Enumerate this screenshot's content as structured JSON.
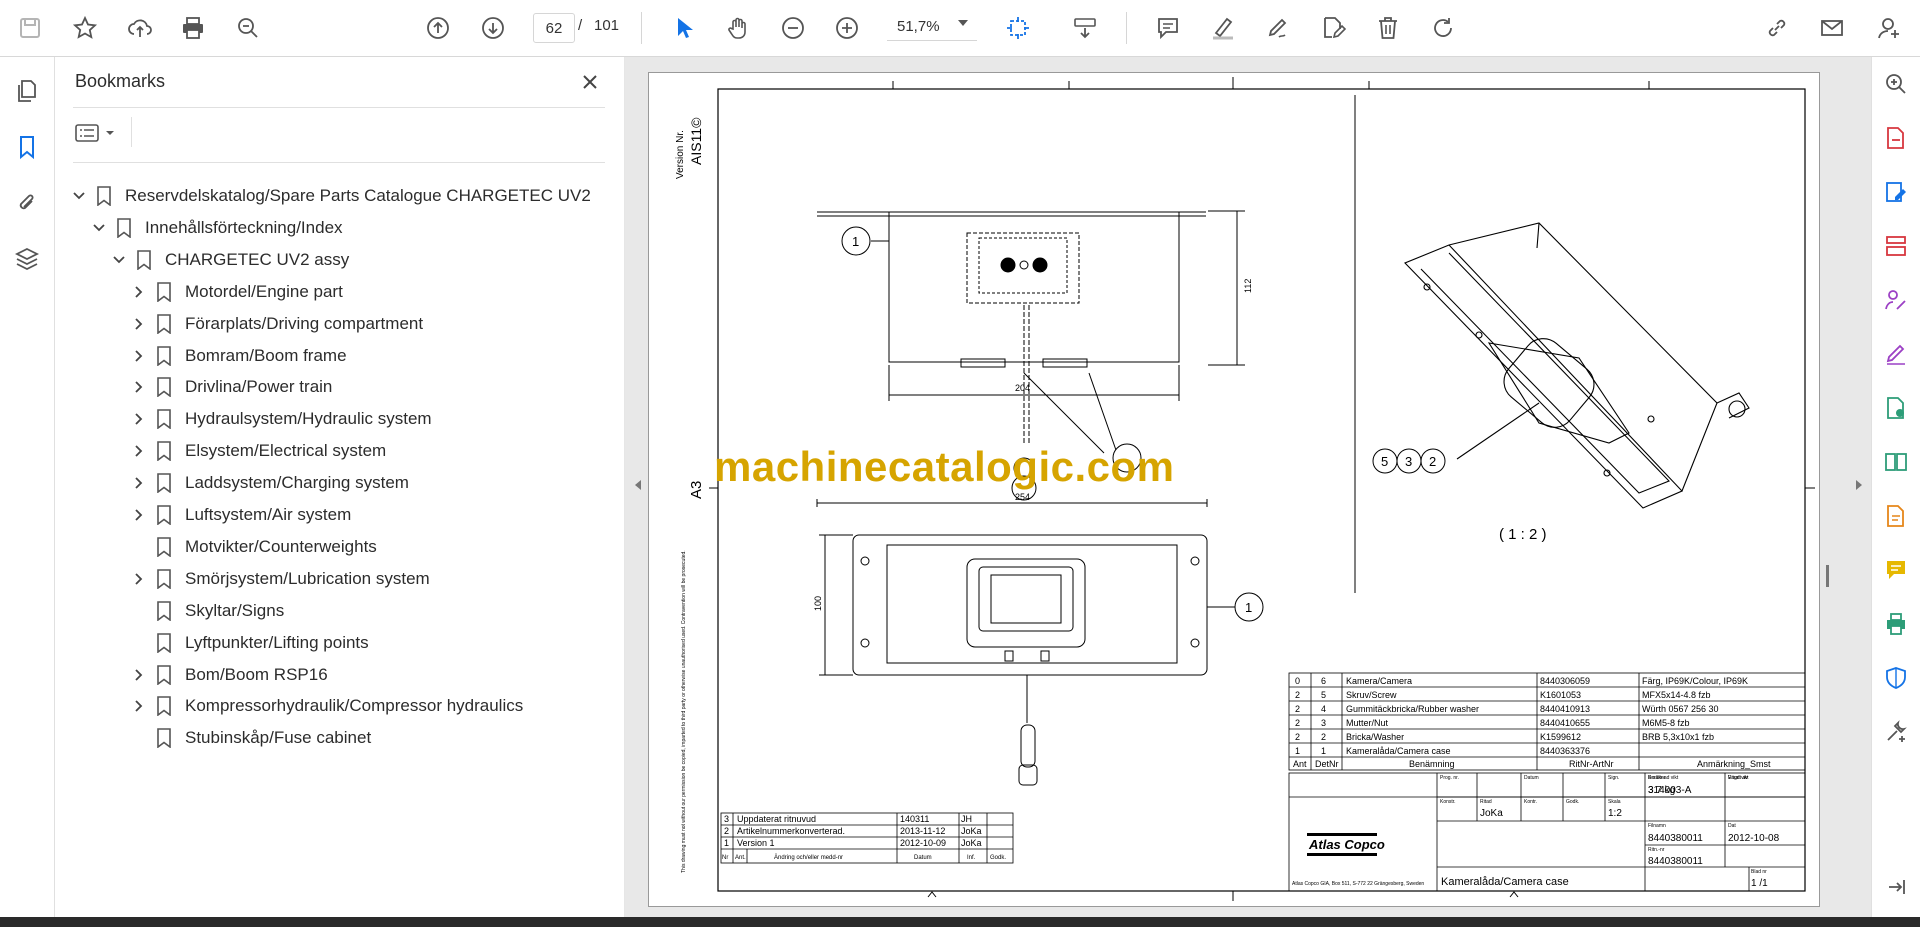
{
  "toolbar": {
    "current_page": "62",
    "page_separator": "/",
    "total_pages": "101",
    "zoom": "51,7%"
  },
  "bookmarks_panel": {
    "title": "Bookmarks",
    "items": [
      {
        "label": "Reservdelskatalog/Spare Parts Catalogue CHARGETEC UV2",
        "level": 0,
        "expanded": true
      },
      {
        "label": "Innehållsförteckning/Index",
        "level": 1,
        "expanded": true
      },
      {
        "label": "CHARGETEC UV2 assy",
        "level": 2,
        "expanded": true
      },
      {
        "label": "Motordel/Engine part",
        "level": 3,
        "expanded": false
      },
      {
        "label": "Förarplats/Driving compartment",
        "level": 3,
        "expanded": false
      },
      {
        "label": "Bomram/Boom frame",
        "level": 3,
        "expanded": false
      },
      {
        "label": "Drivlina/Power train",
        "level": 3,
        "expanded": false
      },
      {
        "label": "Hydraulsystem/Hydraulic system",
        "level": 3,
        "expanded": false
      },
      {
        "label": "Elsystem/Electrical system",
        "level": 3,
        "expanded": false
      },
      {
        "label": "Laddsystem/Charging system",
        "level": 3,
        "expanded": false
      },
      {
        "label": "Luftsystem/Air system",
        "level": 3,
        "expanded": false
      },
      {
        "label": "Motvikter/Counterweights",
        "level": 3,
        "expanded": null
      },
      {
        "label": "Smörjsystem/Lubrication system",
        "level": 3,
        "expanded": false
      },
      {
        "label": "Skyltar/Signs",
        "level": 3,
        "expanded": null
      },
      {
        "label": "Lyftpunkter/Lifting points",
        "level": 3,
        "expanded": null
      },
      {
        "label": "Bom/Boom RSP16",
        "level": 3,
        "expanded": false
      },
      {
        "label": "Kompressorhydraulik/Compressor hydraulics",
        "level": 3,
        "expanded": false
      },
      {
        "label": "Stubinskåp/Fuse cabinet",
        "level": 3,
        "expanded": null
      }
    ]
  },
  "drawing": {
    "version_label": "Version Nr.",
    "version_value": "AIS11©",
    "sheet_size": "A3",
    "watermark": "machinecatalogic.com",
    "scale_caption": "( 1 : 2 )",
    "dimensions": {
      "d112": "112",
      "d204": "204",
      "d254": "254",
      "d100": "100"
    },
    "callouts": {
      "c1": "1",
      "c5": "5",
      "c3": "3",
      "c2": "2"
    },
    "side_note": "This drawing must not without our permission be copied, imparted to third party or otherwise unauthorised used. Contravention will be prosecuted.",
    "parts_list": {
      "rows": [
        {
          "ant": "0",
          "detnr": "6",
          "benamning": "Kamera/Camera",
          "ritnr": "8440306059",
          "anm": "Färg, IP69K/Colour, IP69K"
        },
        {
          "ant": "2",
          "detnr": "5",
          "benamning": "Skruv/Screw",
          "ritnr": "K1601053",
          "anm": "MFX5x14-4.8 fzb"
        },
        {
          "ant": "2",
          "detnr": "4",
          "benamning": "Gummitäckbricka/Rubber washer",
          "ritnr": "8440410913",
          "anm": "Würth 0567 256 30"
        },
        {
          "ant": "2",
          "detnr": "3",
          "benamning": "Mutter/Nut",
          "ritnr": "8440410655",
          "anm": "M6M5-8 fzb"
        },
        {
          "ant": "2",
          "detnr": "2",
          "benamning": "Bricka/Washer",
          "ritnr": "K1599612",
          "anm": "BRB 5,3x10x1 fzb"
        },
        {
          "ant": "1",
          "detnr": "1",
          "benamning": "Kameralåda/Camera case",
          "ritnr": "8440363376",
          "anm": ""
        }
      ],
      "headers": {
        "ant": "Ant",
        "detnr": "DetNr",
        "benamning": "Benämning",
        "ritnr": "RitNr-ArtNr",
        "anm": "Anmärkning_Smst"
      }
    },
    "revisions": {
      "rows": [
        {
          "nr": "3",
          "text": "Uppdaterat ritnuvud",
          "datum": "140311",
          "init": "JH"
        },
        {
          "nr": "2",
          "text": "Artikelnummerkonverterad.",
          "datum": "2013-11-12",
          "init": "JoKa"
        },
        {
          "nr": "1",
          "text": "Version 1",
          "datum": "2012-10-09",
          "init": "JoKa"
        }
      ],
      "headers": {
        "nr": "Nr",
        "ant": "Ant.",
        "text": "Ändring och/eller medd-nr",
        "datum": "Datum",
        "init": "Inf.",
        "godk": "Godk."
      }
    },
    "title_block": {
      "logo": "Atlas Copco",
      "address": "Atlas Copco GIA, Box 511, S-772 22 Grängesberg, Sweden",
      "konstr_label": "Konstr.",
      "ritad_label": "Ritad",
      "ritad_value": "JoKa",
      "kontr_label": "Kontr.",
      "godk_label": "Godk.",
      "skala_label": "Skala",
      "skala_value": "1:2",
      "ersatter_label": "Ersätter",
      "ersatter_value": "314003-A",
      "ersatt_av_label": "Ersatt av",
      "prog_label": "Prog. nr.",
      "datum_label": "Datum",
      "sign_label": "Sign.",
      "vikt_label": "Beräknad vikt",
      "vikt_value": "3.7 kg",
      "vagd_label": "Vägd vikt",
      "filnamn_label": "Filnamn",
      "filnamn_value": "8440380011",
      "dat_label": "Dat",
      "dat_value": "2012-10-08",
      "ritnr_label": "Ritn.-nr",
      "ritnr_value": "8440380011",
      "blad_label": "Blad nr",
      "blad_value": "1 /1",
      "title": "Kameralåda/Camera case"
    }
  }
}
